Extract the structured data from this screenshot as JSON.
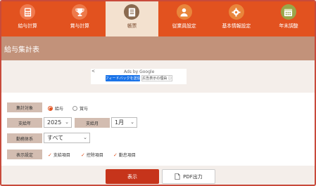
{
  "nav": {
    "items": [
      {
        "label": "給与計算",
        "icon": "calculator-icon",
        "color": "#f07a4f",
        "active": false
      },
      {
        "label": "賞与計算",
        "icon": "trophy-icon",
        "color": "#ee7a4a",
        "active": false
      },
      {
        "label": "帳票",
        "icon": "document-icon",
        "color": "#8a6a4f",
        "active": true
      },
      {
        "label": "従業員設定",
        "icon": "person-icon",
        "color": "#e9853b",
        "active": false
      },
      {
        "label": "基本情報設定",
        "icon": "gear-icon",
        "color": "#e9853b",
        "active": false
      },
      {
        "label": "年末調整",
        "icon": "calendar-icon",
        "color": "#9aa64a",
        "active": false
      }
    ]
  },
  "page": {
    "title": "給与集計表"
  },
  "ad": {
    "back": "<",
    "by": "Ads by Google",
    "feedback": "フィードバックを送信",
    "why": "広告表示の理由 ⓘ"
  },
  "form": {
    "target_label": "集計対象",
    "target_options": [
      "給与",
      "賞与"
    ],
    "target_selected": "給与",
    "year_label": "支給年",
    "year_value": "2025",
    "month_label": "支給月",
    "month_value": "1月",
    "employment_label": "勤務体系",
    "employment_value": "すべて",
    "display_label": "表示設定",
    "display_options": [
      "支給項目",
      "控除項目",
      "勤怠項目"
    ]
  },
  "buttons": {
    "show": "表示",
    "pdf": "PDF出力"
  },
  "colors": {
    "accent": "#e2521f",
    "primary_button": "#c6341b"
  }
}
